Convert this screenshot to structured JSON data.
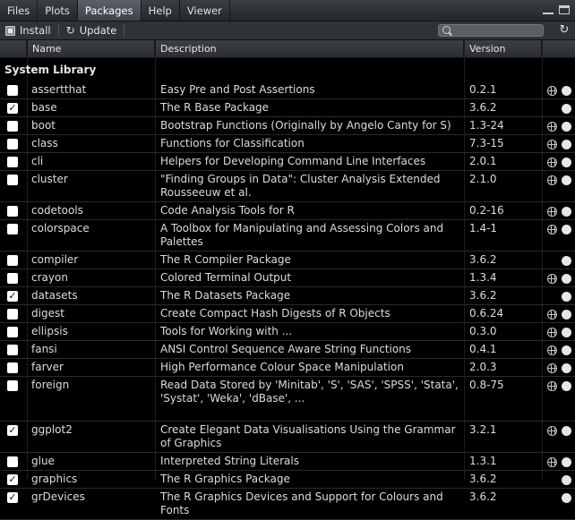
{
  "tabs": [
    {
      "label": "Files",
      "active": false
    },
    {
      "label": "Plots",
      "active": false
    },
    {
      "label": "Packages",
      "active": true
    },
    {
      "label": "Help",
      "active": false
    },
    {
      "label": "Viewer",
      "active": false
    }
  ],
  "toolbar": {
    "install_label": "Install",
    "update_label": "Update",
    "search_placeholder": "",
    "search_value": ""
  },
  "columns": {
    "name": "Name",
    "description": "Description",
    "version": "Version"
  },
  "section_title": "System Library",
  "packages": [
    {
      "name": "assertthat",
      "description": "Easy Pre and Post Assertions",
      "version": "0.2.1",
      "checked": false,
      "has_web": true,
      "lines": 1
    },
    {
      "name": "base",
      "description": "The R Base Package",
      "version": "3.6.2",
      "checked": true,
      "has_web": false,
      "lines": 1
    },
    {
      "name": "boot",
      "description": "Bootstrap Functions (Originally by Angelo Canty for S)",
      "version": "1.3-24",
      "checked": false,
      "has_web": true,
      "lines": 1
    },
    {
      "name": "class",
      "description": "Functions for Classification",
      "version": "7.3-15",
      "checked": false,
      "has_web": true,
      "lines": 1
    },
    {
      "name": "cli",
      "description": "Helpers for Developing Command Line Interfaces",
      "version": "2.0.1",
      "checked": false,
      "has_web": true,
      "lines": 1
    },
    {
      "name": "cluster",
      "description": "\"Finding Groups in Data\": Cluster Analysis Extended Rousseeuw et al.",
      "version": "2.1.0",
      "checked": false,
      "has_web": true,
      "lines": 2
    },
    {
      "name": "codetools",
      "description": "Code Analysis Tools for R",
      "version": "0.2-16",
      "checked": false,
      "has_web": true,
      "lines": 1
    },
    {
      "name": "colorspace",
      "description": "A Toolbox for Manipulating and Assessing Colors and Palettes",
      "version": "1.4-1",
      "checked": false,
      "has_web": true,
      "lines": 2
    },
    {
      "name": "compiler",
      "description": "The R Compiler Package",
      "version": "3.6.2",
      "checked": false,
      "has_web": false,
      "lines": 1
    },
    {
      "name": "crayon",
      "description": "Colored Terminal Output",
      "version": "1.3.4",
      "checked": false,
      "has_web": true,
      "lines": 1
    },
    {
      "name": "datasets",
      "description": "The R Datasets Package",
      "version": "3.6.2",
      "checked": true,
      "has_web": false,
      "lines": 1
    },
    {
      "name": "digest",
      "description": "Create Compact Hash Digests of R Objects",
      "version": "0.6.24",
      "checked": false,
      "has_web": true,
      "lines": 1
    },
    {
      "name": "ellipsis",
      "description": "Tools for Working with ...",
      "version": "0.3.0",
      "checked": false,
      "has_web": true,
      "lines": 1
    },
    {
      "name": "fansi",
      "description": "ANSI Control Sequence Aware String Functions",
      "version": "0.4.1",
      "checked": false,
      "has_web": true,
      "lines": 1
    },
    {
      "name": "farver",
      "description": "High Performance Colour Space Manipulation",
      "version": "2.0.3",
      "checked": false,
      "has_web": true,
      "lines": 1
    },
    {
      "name": "foreign",
      "description": "Read Data Stored by 'Minitab', 'S', 'SAS', 'SPSS', 'Stata', 'Systat', 'Weka', 'dBase', ...",
      "version": "0.8-75",
      "checked": false,
      "has_web": true,
      "lines": 3
    },
    {
      "name": "ggplot2",
      "description": "Create Elegant Data Visualisations Using the Grammar of Graphics",
      "version": "3.2.1",
      "checked": true,
      "has_web": true,
      "lines": 2
    },
    {
      "name": "glue",
      "description": "Interpreted String Literals",
      "version": "1.3.1",
      "checked": false,
      "has_web": true,
      "lines": 1
    },
    {
      "name": "graphics",
      "description": "The R Graphics Package",
      "version": "3.6.2",
      "checked": true,
      "has_web": false,
      "lines": 1
    },
    {
      "name": "grDevices",
      "description": "The R Graphics Devices and Support for Colours and Fonts",
      "version": "3.6.2",
      "checked": true,
      "has_web": false,
      "lines": 2
    }
  ]
}
